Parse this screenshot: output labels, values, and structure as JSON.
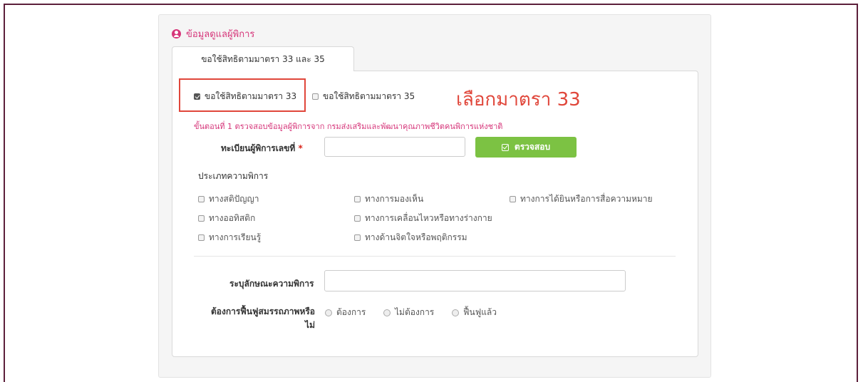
{
  "section": {
    "title": "ข้อมูลดูแลผู้พิการ",
    "icon": "user-circle-icon"
  },
  "tab": {
    "label": "ขอใช้สิทธิตามมาตรา 33 และ 35"
  },
  "rights": {
    "option_33": {
      "label": "ขอใช้สิทธิตามมาตรา 33",
      "checked": true
    },
    "option_35": {
      "label": "ขอใช้สิทธิตามมาตรา 35",
      "checked": false
    }
  },
  "annotation": {
    "text": "เลือกมาตรา 33",
    "color": "#e0463a"
  },
  "step1": {
    "text": "ขั้นตอนที่ 1 ตรวจสอบข้อมูลผู้พิการจาก กรมส่งเสริมและพัฒนาคุณภาพชีวิตคนพิการแห่งชาติ"
  },
  "registration": {
    "label": "ทะเบียนผู้พิการเลขที่",
    "required_mark": "*",
    "value": ""
  },
  "verify_button": {
    "label": "ตรวจสอบ",
    "color": "#7cc243"
  },
  "disability_types": {
    "label": "ประเภทความพิการ",
    "items": [
      "ทางสติปัญญา",
      "ทางการมองเห็น",
      "ทางการได้ยินหรือการสื่อความหมาย",
      "ทางออทิสติก",
      "ทางการเคลื่อนไหวหรือทางร่างกาย",
      "ทางการเรียนรู้",
      "ทางด้านจิตใจหรือพฤติกรรม"
    ]
  },
  "characteristics": {
    "label": "ระบุลักษณะความพิการ",
    "value": ""
  },
  "rehab": {
    "label_line1": "ต้องการฟื้นฟูสมรรถภาพหรือ",
    "label_line2": "ไม่",
    "options": [
      "ต้องการ",
      "ไม่ต้องการ",
      "ฟื้นฟูแล้ว"
    ]
  },
  "colors": {
    "accent": "#d6367a",
    "frame": "#5c1f3a"
  }
}
